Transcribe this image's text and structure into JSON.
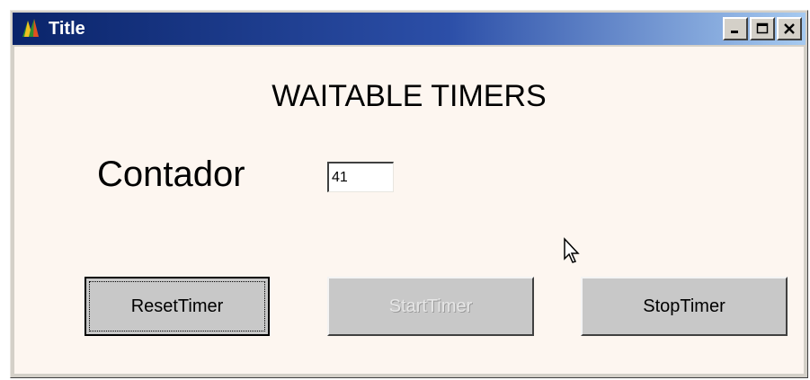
{
  "window": {
    "title": "Title",
    "colors": {
      "titlebar_start": "#0a246a",
      "titlebar_end": "#a6caf0",
      "client_bg": "#fdf6f0"
    }
  },
  "main": {
    "heading": "WAITABLE TIMERS",
    "counter_label": "Contador",
    "counter_value": "41"
  },
  "buttons": {
    "reset": "ResetTimer",
    "start": "StartTimer",
    "stop": "StopTimer"
  },
  "icons": {
    "app": "app-icon",
    "minimize": "minimize-icon",
    "maximize": "maximize-icon",
    "close": "close-icon",
    "cursor": "mouse-pointer-icon"
  }
}
